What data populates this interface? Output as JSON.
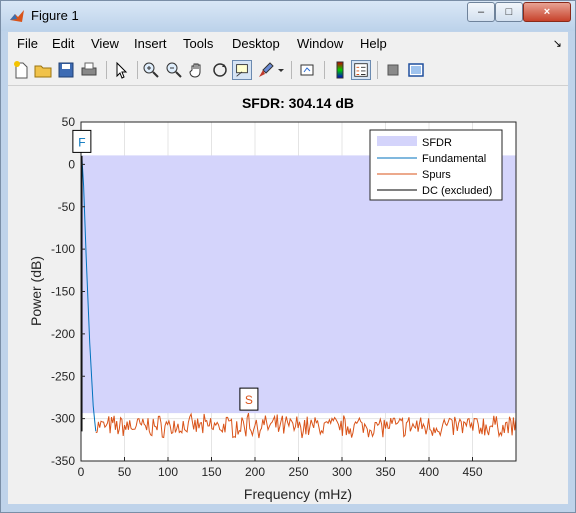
{
  "window": {
    "title": "Figure 1",
    "controls": {
      "minimize": "–",
      "maximize": "□",
      "close": "×"
    }
  },
  "menu": [
    "File",
    "Edit",
    "View",
    "Insert",
    "Tools",
    "Desktop",
    "Window",
    "Help"
  ],
  "menu_arrow": "↘",
  "toolbar": [
    "new-figure",
    "open-file",
    "save",
    "print",
    "pointer",
    "zoom-in",
    "zoom-out",
    "pan",
    "rotate-3d",
    "data-cursor",
    "brush",
    "brush-dropdown",
    "link-plot",
    "insert-colorbar",
    "insert-legend",
    "hide-plot-tools",
    "show-plot-tools"
  ],
  "chart_data": {
    "type": "area",
    "title": "SFDR: 304.14 dB",
    "xlabel": "Frequency (mHz)",
    "ylabel": "Power (dB)",
    "xlim": [
      0,
      500
    ],
    "ylim": [
      -350,
      50
    ],
    "xticks": [
      0,
      50,
      100,
      150,
      200,
      250,
      300,
      350,
      400,
      450
    ],
    "yticks": [
      50,
      0,
      -50,
      -100,
      -150,
      -200,
      -250,
      -300,
      -350
    ],
    "sfdr": {
      "top_db": 10.6,
      "bottom_db": -293.5,
      "x_from": 0,
      "x_to": 500
    },
    "series": [
      {
        "name": "SFDR",
        "color": "#d4d4fb"
      },
      {
        "name": "Fundamental",
        "color": "#0072bd",
        "x": [
          0,
          1,
          3,
          6,
          10,
          14,
          16,
          17
        ],
        "y": [
          10.6,
          8,
          -25,
          -110,
          -210,
          -285,
          -305,
          -315
        ]
      },
      {
        "name": "Spurs",
        "color": "#d95319",
        "x_start": 17,
        "x_end": 500,
        "y_range": [
          -323,
          -293.5
        ]
      },
      {
        "name": "DC (excluded)",
        "color": "#000000",
        "x": [
          0,
          0
        ],
        "y": [
          -315,
          10
        ]
      }
    ],
    "markers": [
      {
        "label": "F",
        "x": 1,
        "y": 10.6
      },
      {
        "label": "S",
        "x": 193,
        "y": -293.5
      }
    ],
    "grid": true,
    "legend": "top-right"
  }
}
